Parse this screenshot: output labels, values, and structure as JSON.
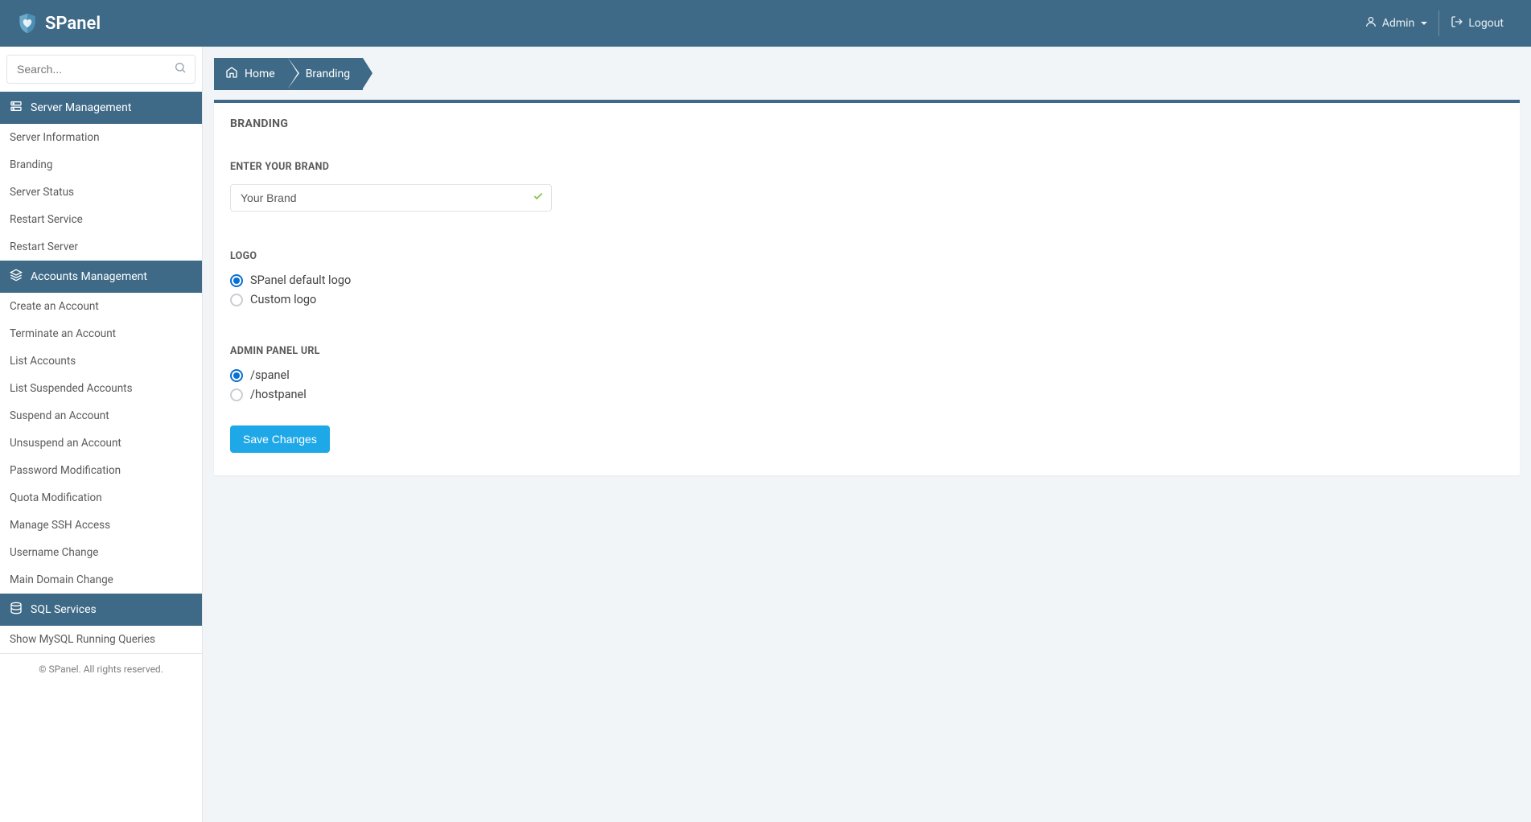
{
  "header": {
    "app_name": "SPanel",
    "user_label": "Admin",
    "logout_label": "Logout"
  },
  "sidebar": {
    "search_placeholder": "Search...",
    "sections": [
      {
        "title": "Server Management",
        "items": [
          "Server Information",
          "Branding",
          "Server Status",
          "Restart Service",
          "Restart Server"
        ]
      },
      {
        "title": "Accounts Management",
        "items": [
          "Create an Account",
          "Terminate an Account",
          "List Accounts",
          "List Suspended Accounts",
          "Suspend an Account",
          "Unsuspend an Account",
          "Password Modification",
          "Quota Modification",
          "Manage SSH Access",
          "Username Change",
          "Main Domain Change"
        ]
      },
      {
        "title": "SQL Services",
        "items": [
          "Show MySQL Running Queries"
        ]
      }
    ],
    "copyright": "© SPanel. All rights reserved."
  },
  "breadcrumb": {
    "home": "Home",
    "current": "Branding"
  },
  "form": {
    "card_title": "BRANDING",
    "brand_section_label": "ENTER YOUR BRAND",
    "brand_value": "Your Brand",
    "logo_section_label": "LOGO",
    "logo_options": [
      "SPanel default logo",
      "Custom logo"
    ],
    "logo_selected_index": 0,
    "url_section_label": "ADMIN PANEL URL",
    "url_options": [
      "/spanel",
      "/hostpanel"
    ],
    "url_selected_index": 0,
    "save_label": "Save Changes"
  }
}
